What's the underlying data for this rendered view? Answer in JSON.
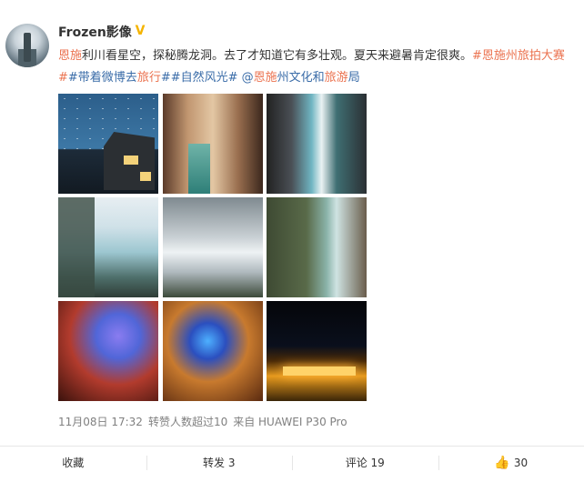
{
  "post": {
    "username": "Frozen影像",
    "verified_badge": "V",
    "text_segments": [
      {
        "text": "恩施",
        "style": "hl"
      },
      {
        "text": "利川看星空，探秘腾龙洞。去了才知道它有多壮观。夏天来避暑肯定很爽。",
        "style": "plain"
      },
      {
        "text": "#恩施州旅拍大赛#",
        "style": "hl"
      },
      {
        "text": "#带着微博去",
        "style": "lk"
      },
      {
        "text": "旅行",
        "style": "hl"
      },
      {
        "text": "##自然风光# @",
        "style": "lk"
      },
      {
        "text": "恩施",
        "style": "hl"
      },
      {
        "text": "州文化和",
        "style": "lk"
      },
      {
        "text": "旅游",
        "style": "hl"
      },
      {
        "text": "局",
        "style": "lk"
      }
    ],
    "images": [
      {
        "name": "starry-sky-house-photo"
      },
      {
        "name": "cave-stream-photo"
      },
      {
        "name": "canyon-river-photo"
      },
      {
        "name": "waterfall-photo"
      },
      {
        "name": "cloud-sea-photo"
      },
      {
        "name": "gorge-river-photo"
      },
      {
        "name": "colorful-cave-photo"
      },
      {
        "name": "lit-cave-photo"
      },
      {
        "name": "night-performance-photo"
      }
    ],
    "meta": {
      "date": "11月08日 17:32",
      "forwards_note": "转赞人数超过10",
      "source": "来自 HUAWEI P30 Pro"
    }
  },
  "actions": {
    "favorite_label": "收藏",
    "repost_label": "转发 3",
    "comment_label": "评论 19",
    "like_count": "30"
  }
}
